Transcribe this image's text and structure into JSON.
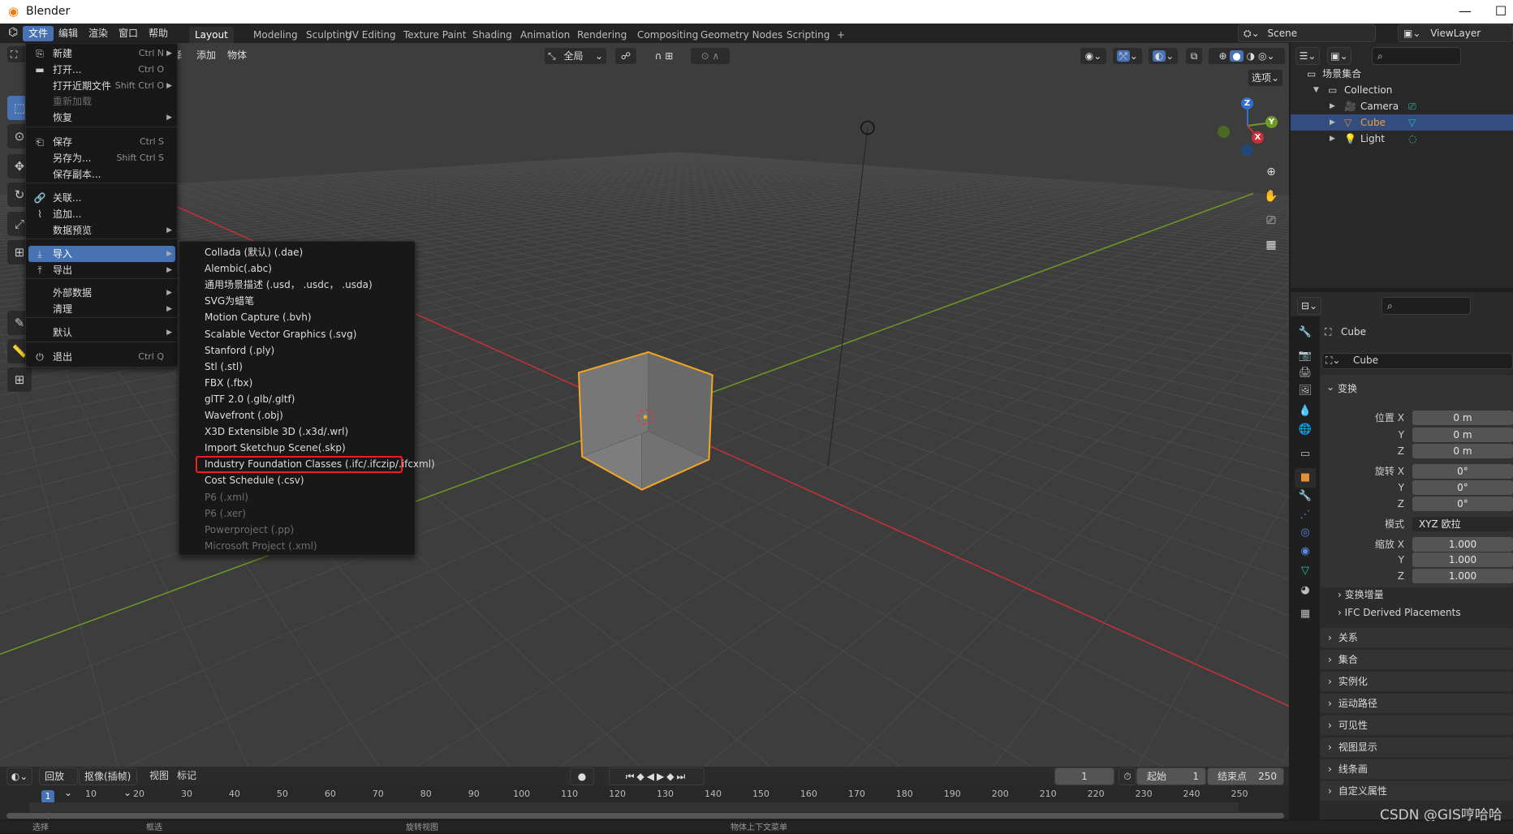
{
  "window": {
    "title": "Blender",
    "minimize_icon": "minimize-icon",
    "maximize_icon": "maximize-icon"
  },
  "topbar": {
    "menus": [
      "文件",
      "编辑",
      "渲染",
      "窗口",
      "帮助"
    ],
    "active_menu": 0,
    "workspaces": [
      "Layout",
      "Modeling",
      "Sculpting",
      "UV Editing",
      "Texture Paint",
      "Shading",
      "Animation",
      "Rendering",
      "Compositing",
      "Geometry Nodes",
      "Scripting",
      "+"
    ],
    "active_workspace": 0,
    "scene": "Scene",
    "view_layer": "ViewLayer"
  },
  "viewport": {
    "menus": [
      "选择",
      "添加",
      "物体"
    ],
    "transform_orientation": "全局",
    "options_label": "选项",
    "shading_mode": "solid",
    "axis_labels": {
      "x": "X",
      "y": "Y",
      "z": "Z"
    },
    "colors": {
      "x_axis": "#c9303a",
      "y_axis": "#6d9a24",
      "selection": "#f5a623",
      "accent": "#4772b3"
    }
  },
  "file_menu": {
    "items": [
      {
        "label": "新建",
        "shortcut": "Ctrl N",
        "submenu": true,
        "icon": "new-file-icon"
      },
      {
        "label": "打开...",
        "shortcut": "Ctrl O",
        "icon": "folder-icon"
      },
      {
        "label": "打开近期文件",
        "shortcut": "Shift Ctrl O",
        "submenu": true
      },
      {
        "label": "重新加载",
        "disabled": true
      },
      {
        "label": "恢复",
        "submenu": true
      },
      {
        "label": "保存",
        "shortcut": "Ctrl S",
        "icon": "save-icon"
      },
      {
        "label": "另存为...",
        "shortcut": "Shift Ctrl S"
      },
      {
        "label": "保存副本..."
      },
      {
        "label": "关联...",
        "icon": "link-icon"
      },
      {
        "label": "追加...",
        "icon": "paperclip-icon"
      },
      {
        "label": "数据预览",
        "submenu": true
      },
      {
        "label": "导入",
        "submenu": true,
        "icon": "import-icon",
        "highlighted": true
      },
      {
        "label": "导出",
        "submenu": true,
        "icon": "export-icon"
      },
      {
        "label": "外部数据",
        "submenu": true
      },
      {
        "label": "清理",
        "submenu": true
      },
      {
        "label": "默认",
        "submenu": true
      },
      {
        "label": "退出",
        "shortcut": "Ctrl Q",
        "icon": "power-icon"
      }
    ]
  },
  "import_menu": {
    "items": [
      {
        "label": "Collada (默认) (.dae)"
      },
      {
        "label": "Alembic(.abc)"
      },
      {
        "label": "通用场景描述 (.usd， .usdc， .usda)"
      },
      {
        "label": "SVG为蜡笔"
      },
      {
        "label": "Motion Capture (.bvh)"
      },
      {
        "label": "Scalable Vector Graphics (.svg)"
      },
      {
        "label": "Stanford (.ply)"
      },
      {
        "label": "Stl (.stl)"
      },
      {
        "label": "FBX (.fbx)"
      },
      {
        "label": "glTF 2.0 (.glb/.gltf)"
      },
      {
        "label": "Wavefront (.obj)"
      },
      {
        "label": "X3D Extensible 3D (.x3d/.wrl)"
      },
      {
        "label": "Import Sketchup Scene(.skp)"
      },
      {
        "label": "Industry Foundation Classes (.ifc/.ifczip/.ifcxml)",
        "boxed": true
      },
      {
        "label": "Cost Schedule (.csv)"
      },
      {
        "label": "P6 (.xml)",
        "disabled": true
      },
      {
        "label": "P6 (.xer)",
        "disabled": true
      },
      {
        "label": "Powerproject (.pp)",
        "disabled": true
      },
      {
        "label": "Microsoft Project (.xml)",
        "disabled": true
      }
    ],
    "highlight_color": "#f01e1e"
  },
  "outliner": {
    "root": "场景集合",
    "items": [
      {
        "label": "Collection",
        "level": 0,
        "icon": "collection-icon"
      },
      {
        "label": "Camera",
        "level": 1,
        "icon": "camera-icon"
      },
      {
        "label": "Cube",
        "level": 1,
        "icon": "mesh-icon",
        "selected": true
      },
      {
        "label": "Light",
        "level": 1,
        "icon": "light-icon"
      }
    ]
  },
  "properties": {
    "object_name": "Cube",
    "datablock_name": "Cube",
    "transform_header": "变换",
    "location": {
      "label": "位置",
      "x": "0 m",
      "y": "0 m",
      "z": "0 m"
    },
    "rotation": {
      "label": "旋转",
      "x": "0°",
      "y": "0°",
      "z": "0°"
    },
    "mode": {
      "label": "模式",
      "value": "XYZ 欧拉"
    },
    "scale": {
      "label": "缩放",
      "x": "1.000",
      "y": "1.000",
      "z": "1.000"
    },
    "axis": {
      "x": "X",
      "y": "Y",
      "z": "Z"
    },
    "sub_panels": [
      "变换增量",
      "IFC Derived Placements"
    ],
    "panels": [
      "关系",
      "集合",
      "实例化",
      "运动路径",
      "可见性",
      "视图显示",
      "线条画",
      "自定义属性"
    ]
  },
  "timeline": {
    "menus": [
      "回放",
      "抠像(插帧)",
      "视图",
      "标记"
    ],
    "current_frame": 1,
    "start_label": "起始",
    "start": 1,
    "end_label": "结束点",
    "end": 250,
    "ticks": [
      10,
      20,
      30,
      40,
      50,
      60,
      70,
      80,
      90,
      100,
      110,
      120,
      130,
      140,
      150,
      160,
      170,
      180,
      190,
      200,
      210,
      220,
      230,
      240,
      250
    ]
  },
  "status": {
    "items": [
      "选择",
      "框选",
      "旋转视图",
      "物体上下文菜单"
    ]
  },
  "watermark": "CSDN @GIS哼哈哈"
}
